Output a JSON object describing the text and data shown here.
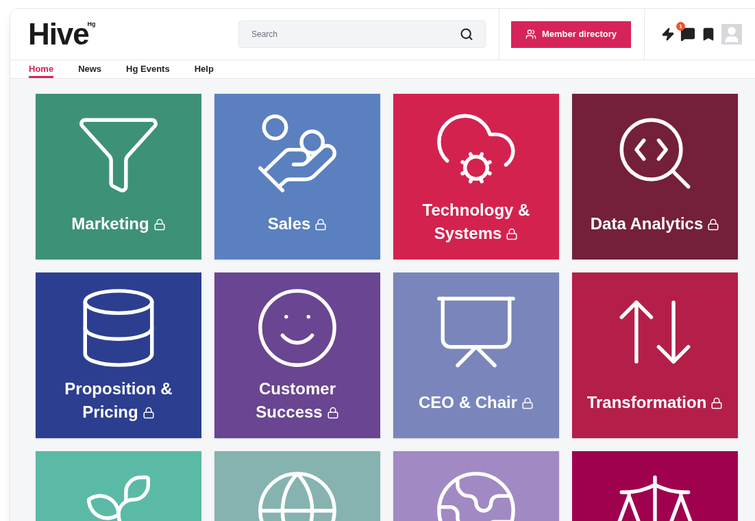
{
  "header": {
    "logo": "Hive",
    "logo_mark": "Hg",
    "search": {
      "placeholder": "Search"
    },
    "member_button": "Member directory",
    "notification_count": "1"
  },
  "nav": [
    {
      "label": "Home",
      "selected": true
    },
    {
      "label": "News",
      "selected": false
    },
    {
      "label": "Hg Events",
      "selected": false
    },
    {
      "label": "Help",
      "selected": false
    }
  ],
  "tiles": [
    {
      "label": "Marketing",
      "locked": true,
      "color": "#3d9178"
    },
    {
      "label": "Sales",
      "locked": true,
      "color": "#5a80bf"
    },
    {
      "label": "Technology & Systems",
      "locked": true,
      "color": "#d4224f"
    },
    {
      "label": "Data Analytics",
      "locked": true,
      "color": "#74203a"
    },
    {
      "label": "Proposition & Pricing",
      "locked": true,
      "color": "#2c3e8f"
    },
    {
      "label": "Customer Success",
      "locked": true,
      "color": "#6a4591"
    },
    {
      "label": "CEO & Chair",
      "locked": true,
      "color": "#7a86bb"
    },
    {
      "label": "Transformation",
      "locked": true,
      "color": "#b41f49"
    },
    {
      "color": "#5bbaa6"
    },
    {
      "color": "#86b3b0"
    },
    {
      "color": "#a189c4"
    },
    {
      "color": "#a0014f"
    }
  ]
}
